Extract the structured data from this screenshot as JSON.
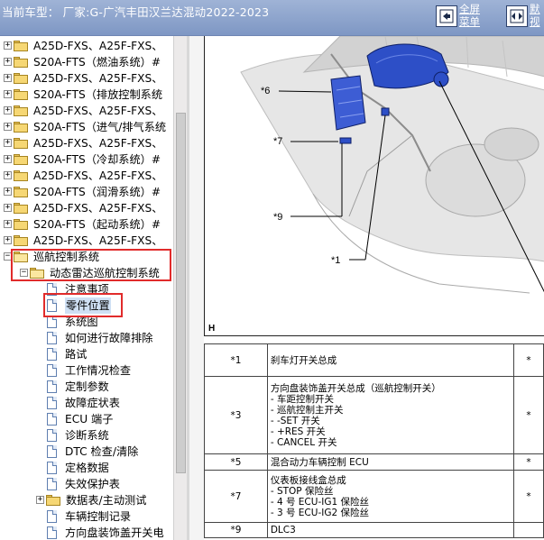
{
  "header": {
    "title": "当前车型：  厂家:G-广汽丰田汉兰达混动2022-2023",
    "fullscreen_top": "全屏",
    "fullscreen_bottom": "菜单",
    "default_top": "默",
    "default_bottom": "视"
  },
  "tree": {
    "items": [
      {
        "label": "A25D-FXS、A25F-FXS、",
        "type": "folder",
        "expander": "+"
      },
      {
        "label": "S20A-FTS（燃油系统）#",
        "type": "folder",
        "expander": "+"
      },
      {
        "label": "A25D-FXS、A25F-FXS、",
        "type": "folder",
        "expander": "+"
      },
      {
        "label": "S20A-FTS（排放控制系统",
        "type": "folder",
        "expander": "+"
      },
      {
        "label": "A25D-FXS、A25F-FXS、",
        "type": "folder",
        "expander": "+"
      },
      {
        "label": "S20A-FTS（进气/排气系统",
        "type": "folder",
        "expander": "+"
      },
      {
        "label": "A25D-FXS、A25F-FXS、",
        "type": "folder",
        "expander": "+"
      },
      {
        "label": "S20A-FTS（冷却系统）#",
        "type": "folder",
        "expander": "+"
      },
      {
        "label": "A25D-FXS、A25F-FXS、",
        "type": "folder",
        "expander": "+"
      },
      {
        "label": "S20A-FTS（润滑系统）#",
        "type": "folder",
        "expander": "+"
      },
      {
        "label": "A25D-FXS、A25F-FXS、",
        "type": "folder",
        "expander": "+"
      },
      {
        "label": "S20A-FTS（起动系统）#",
        "type": "folder",
        "expander": "+"
      },
      {
        "label": "A25D-FXS、A25F-FXS、",
        "type": "folder",
        "expander": "+"
      },
      {
        "label": "巡航控制系统",
        "type": "folder-open",
        "expander": "−"
      },
      {
        "label": "动态雷达巡航控制系统",
        "type": "folder-open",
        "expander": "−"
      },
      {
        "label": "注意事项",
        "type": "doc"
      },
      {
        "label": "零件位置",
        "type": "doc",
        "selected": true
      },
      {
        "label": "系统图",
        "type": "doc"
      },
      {
        "label": "如何进行故障排除",
        "type": "doc"
      },
      {
        "label": "路试",
        "type": "doc"
      },
      {
        "label": "工作情况检查",
        "type": "doc"
      },
      {
        "label": "定制参数",
        "type": "doc"
      },
      {
        "label": "故障症状表",
        "type": "doc"
      },
      {
        "label": "ECU 端子",
        "type": "doc"
      },
      {
        "label": "诊断系统",
        "type": "doc"
      },
      {
        "label": "DTC 检查/清除",
        "type": "doc"
      },
      {
        "label": "定格数据",
        "type": "doc"
      },
      {
        "label": "失效保护表",
        "type": "doc"
      },
      {
        "label": "数据表/主动测试",
        "type": "folder",
        "expander": "+"
      },
      {
        "label": "车辆控制记录",
        "type": "doc"
      },
      {
        "label": "方向盘装饰盖开关电",
        "type": "doc"
      }
    ]
  },
  "illustration": {
    "callouts": [
      "*6",
      "*7",
      "*9",
      "*1"
    ],
    "view_letter": "H"
  },
  "parts_table": [
    {
      "num": "*1",
      "lines": [
        "刹车灯开关总成"
      ],
      "extra": "*"
    },
    {
      "num": "*3",
      "lines": [
        "方向盘装饰盖开关总成（巡航控制开关）",
        "- 车距控制开关",
        "- 巡航控制主开关",
        "- -SET 开关",
        "- +RES 开关",
        "- CANCEL 开关"
      ],
      "extra": "*"
    },
    {
      "num": "*5",
      "lines": [
        "混合动力车辆控制 ECU"
      ],
      "extra": "*"
    },
    {
      "num": "*7",
      "lines": [
        "仪表板接线盒总成",
        "- STOP 保险丝",
        "- 4 号 ECU-IG1 保险丝",
        "- 3 号 ECU-IG2 保险丝"
      ],
      "extra": "*"
    },
    {
      "num": "*9",
      "lines": [
        "DLC3"
      ],
      "extra": ""
    }
  ],
  "colors": {
    "titlebar": "#8aa1cc",
    "highlight": "#e12b2b",
    "selected": "#cfe0f4",
    "part_blue": "#2d4fc7"
  }
}
